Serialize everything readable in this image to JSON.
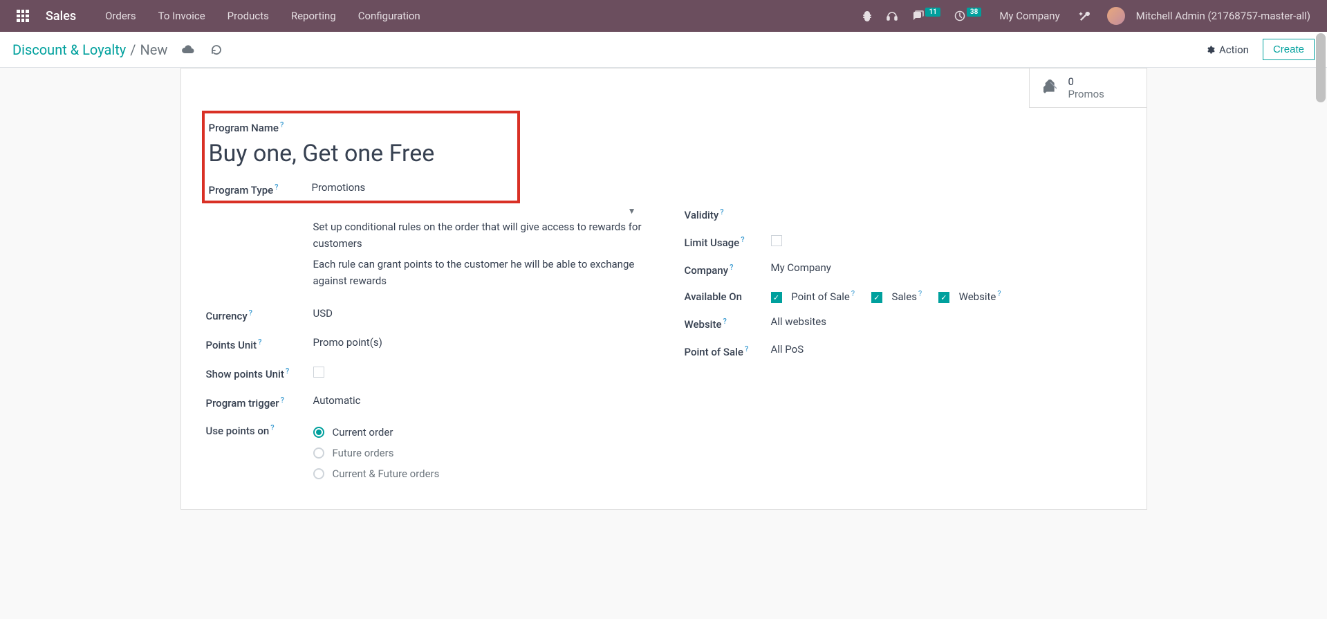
{
  "navbar": {
    "brand": "Sales",
    "links": [
      "Orders",
      "To Invoice",
      "Products",
      "Reporting",
      "Configuration"
    ],
    "messages_count": "11",
    "activities_count": "38",
    "company": "My Company",
    "user": "Mitchell Admin (21768757-master-all)"
  },
  "control_panel": {
    "breadcrumb_root": "Discount & Loyalty",
    "breadcrumb_current": "New",
    "action_label": "Action",
    "create_label": "Create"
  },
  "stat_button": {
    "count": "0",
    "label": "Promos"
  },
  "form": {
    "program_name_label": "Program Name",
    "program_name": "Buy one, Get one Free",
    "program_type_label": "Program Type",
    "program_type": "Promotions",
    "program_type_help1": "Set up conditional rules on the order that will give access to rewards for customers",
    "program_type_help2": "Each rule can grant points to the customer he will be able to exchange against rewards",
    "currency_label": "Currency",
    "currency": "USD",
    "points_unit_label": "Points Unit",
    "points_unit": "Promo point(s)",
    "show_points_label": "Show points Unit",
    "trigger_label": "Program trigger",
    "trigger": "Automatic",
    "use_points_label": "Use points on",
    "use_points_options": [
      "Current order",
      "Future orders",
      "Current & Future orders"
    ],
    "validity_label": "Validity",
    "limit_usage_label": "Limit Usage",
    "company_label": "Company",
    "company": "My Company",
    "available_on_label": "Available On",
    "available_pos": "Point of Sale",
    "available_sales": "Sales",
    "available_website": "Website",
    "website_label": "Website",
    "website_placeholder": "All websites",
    "pos_label": "Point of Sale",
    "pos_placeholder": "All PoS"
  }
}
